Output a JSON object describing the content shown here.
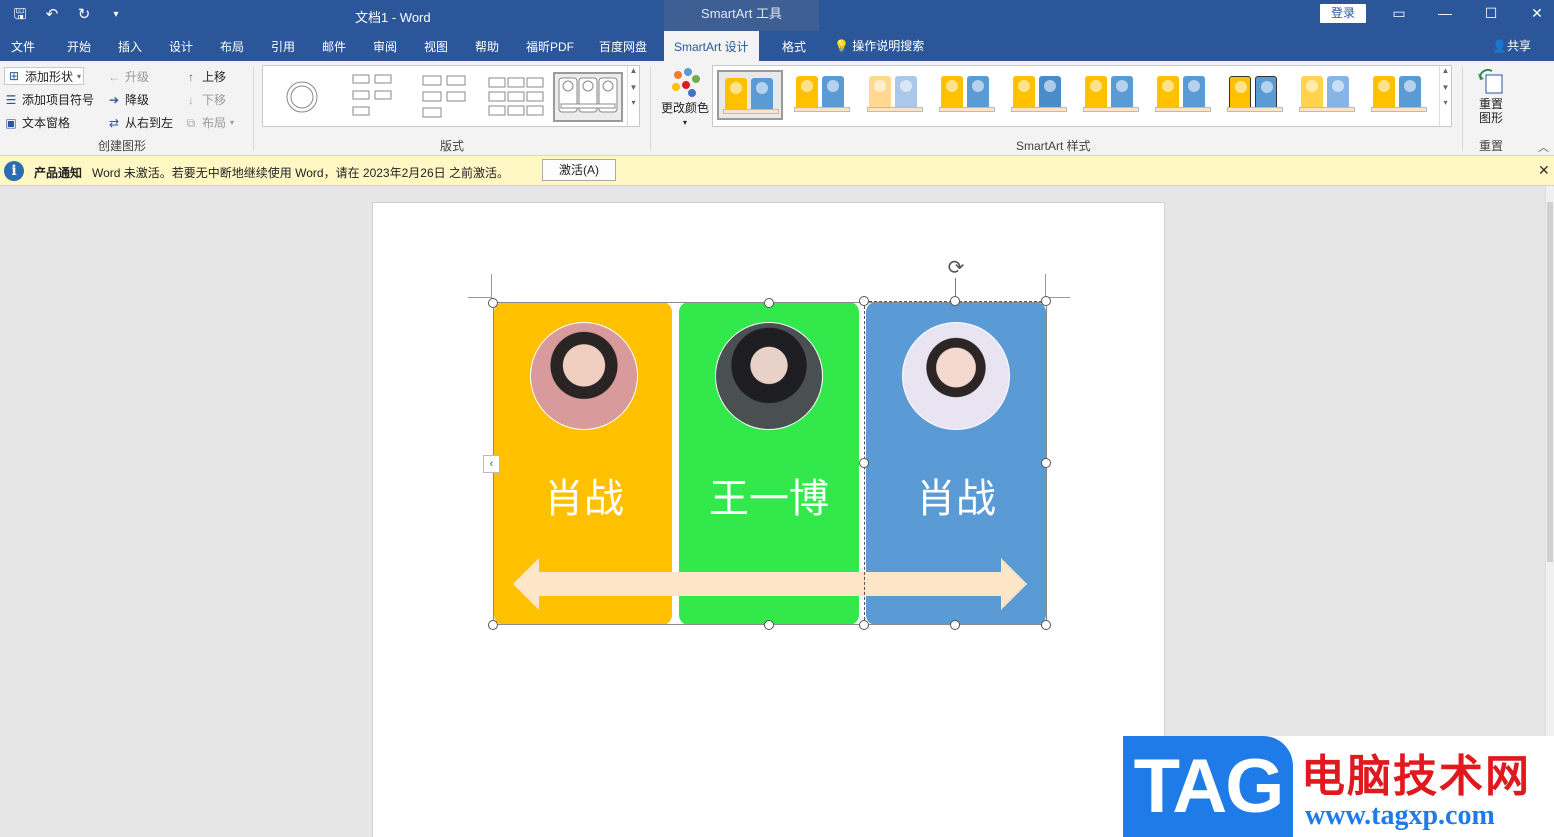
{
  "titlebar": {
    "doc_title": "文档1  -  Word",
    "context_tools": "SmartArt 工具",
    "login": "登录"
  },
  "tabs": [
    {
      "label": "文件"
    },
    {
      "label": "开始"
    },
    {
      "label": "插入"
    },
    {
      "label": "设计"
    },
    {
      "label": "布局"
    },
    {
      "label": "引用"
    },
    {
      "label": "邮件"
    },
    {
      "label": "审阅"
    },
    {
      "label": "视图"
    },
    {
      "label": "帮助"
    },
    {
      "label": "福昕PDF"
    },
    {
      "label": "百度网盘"
    },
    {
      "label": "SmartArt 设计"
    },
    {
      "label": "格式"
    }
  ],
  "tell_me": "操作说明搜索",
  "share": "共享",
  "ribbon": {
    "create_graphic": {
      "label": "创建图形",
      "add_shape": "添加形状",
      "add_bullet": "添加项目符号",
      "text_pane": "文本窗格",
      "promote": "升级",
      "demote": "降级",
      "right_to_left": "从右到左",
      "move_up": "上移",
      "move_down": "下移",
      "layout": "布局"
    },
    "layouts": {
      "label": "版式"
    },
    "change_colors": "更改颜色",
    "smartart_styles": {
      "label": "SmartArt 样式"
    },
    "reset": {
      "button": "重置\n图形",
      "label": "重置"
    }
  },
  "notification": {
    "title": "产品通知",
    "message": "Word 未激活。若要无中断地继续使用 Word，请在 2023年2月26日 之前激活。",
    "button": "激活(A)"
  },
  "smartart": {
    "panels": [
      {
        "name": "肖战",
        "color": "#ffc000"
      },
      {
        "name": "王一博",
        "color": "#33e84a"
      },
      {
        "name": "肖战",
        "color": "#5b9bd5"
      }
    ],
    "arrow_color": "#fde6c8"
  },
  "watermark": {
    "tag": "TAG",
    "site_name": "电脑技术网",
    "url": "www.tagxp.com"
  }
}
